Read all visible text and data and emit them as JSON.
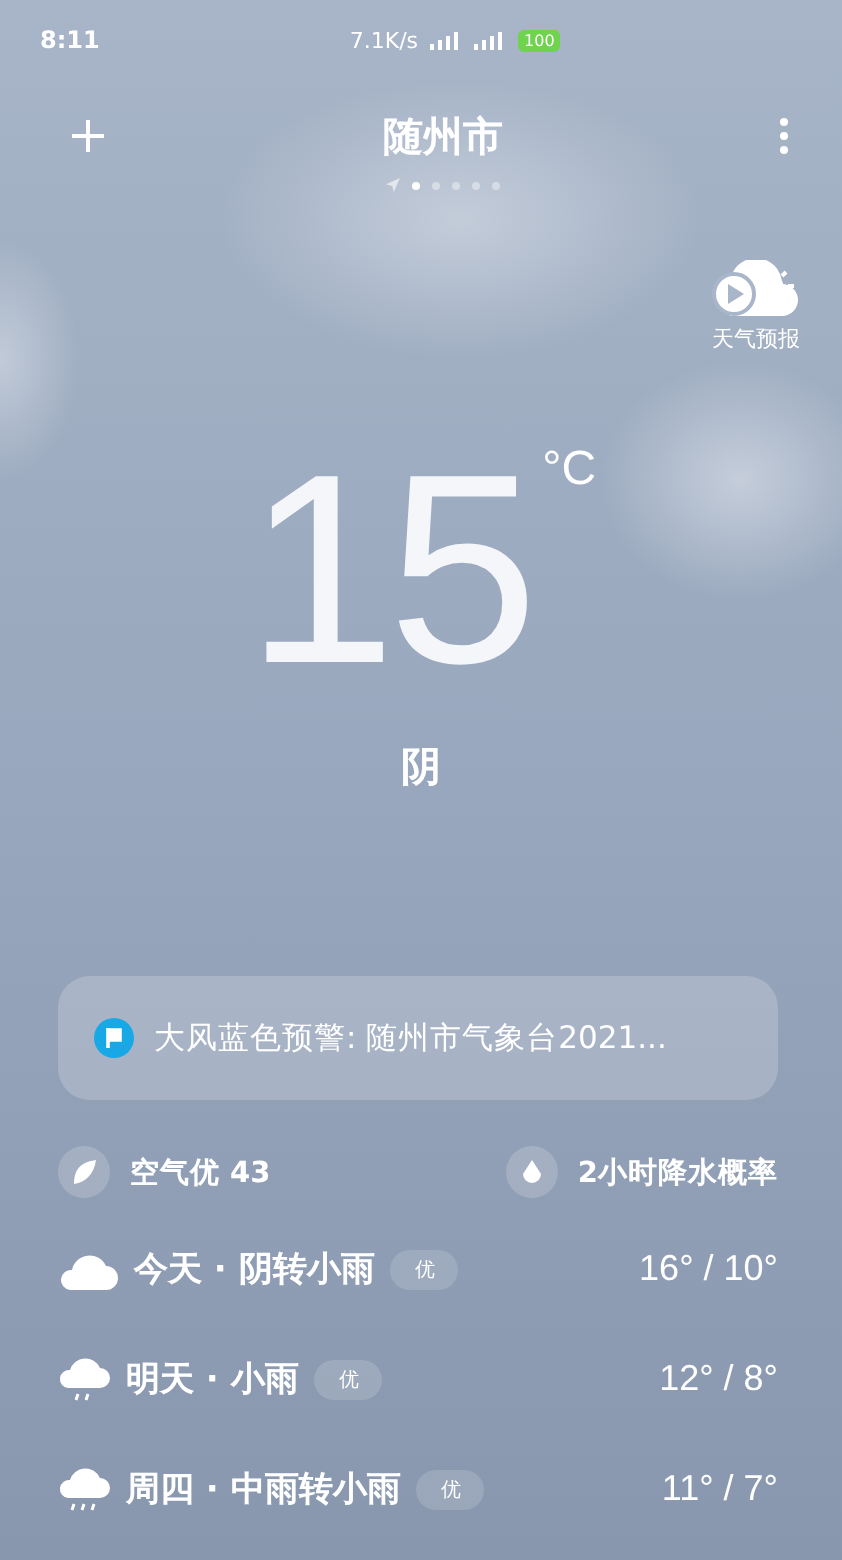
{
  "status_bar": {
    "time": "8:11",
    "speed": "7.1K/s",
    "battery": "100"
  },
  "header": {
    "city": "随州市",
    "pages": [
      {
        "selected": true
      },
      {
        "selected": false
      },
      {
        "selected": false
      },
      {
        "selected": false
      },
      {
        "selected": false
      }
    ]
  },
  "forecast_button": {
    "label": "天气预报"
  },
  "current": {
    "temperature": "15",
    "unit": "°C",
    "condition": "阴"
  },
  "alert": {
    "text": "大风蓝色预警: 随州市气象台2021..."
  },
  "info": [
    {
      "kind": "air",
      "label": "空气优 43"
    },
    {
      "kind": "rain",
      "label": "2小时降水概率"
    }
  ],
  "days": [
    {
      "kind": "cloudy",
      "label": "今天 · 阴转小雨",
      "badge": "优",
      "temps": "16° / 10°"
    },
    {
      "kind": "rain",
      "label": "明天 · 小雨",
      "badge": "优",
      "temps": "12° / 8°"
    },
    {
      "kind": "heavy-rain",
      "label": "周四 · 中雨转小雨",
      "badge": "优",
      "temps": "11° / 7°"
    }
  ]
}
